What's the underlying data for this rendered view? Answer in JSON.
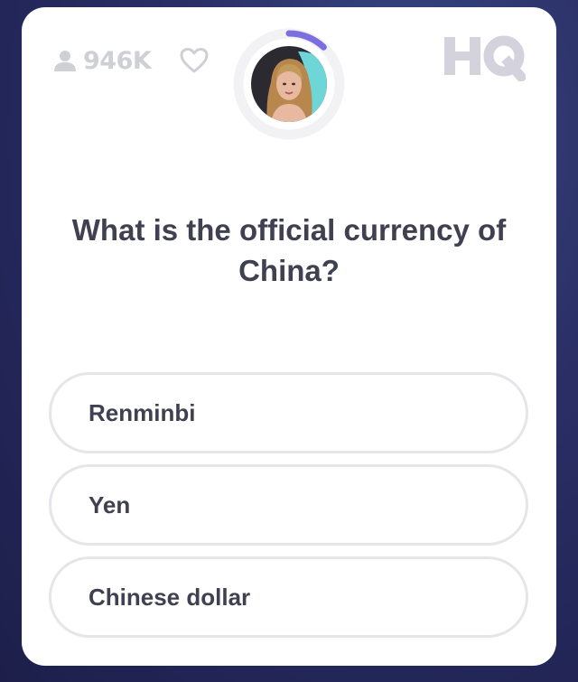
{
  "stats": {
    "viewer_count": "946K"
  },
  "logo": {
    "text": "HQ",
    "color": "#d4d3dd"
  },
  "timer": {
    "progress": 0.12,
    "color": "#7b6fdf",
    "track_color": "#f2f2f4"
  },
  "question": {
    "text": "What is the official currency of China?"
  },
  "answers": [
    {
      "label": "Renminbi"
    },
    {
      "label": "Yen"
    },
    {
      "label": "Chinese dollar"
    }
  ],
  "icons": {
    "viewer": "person-icon",
    "like": "heart-icon",
    "host": "host-avatar"
  }
}
